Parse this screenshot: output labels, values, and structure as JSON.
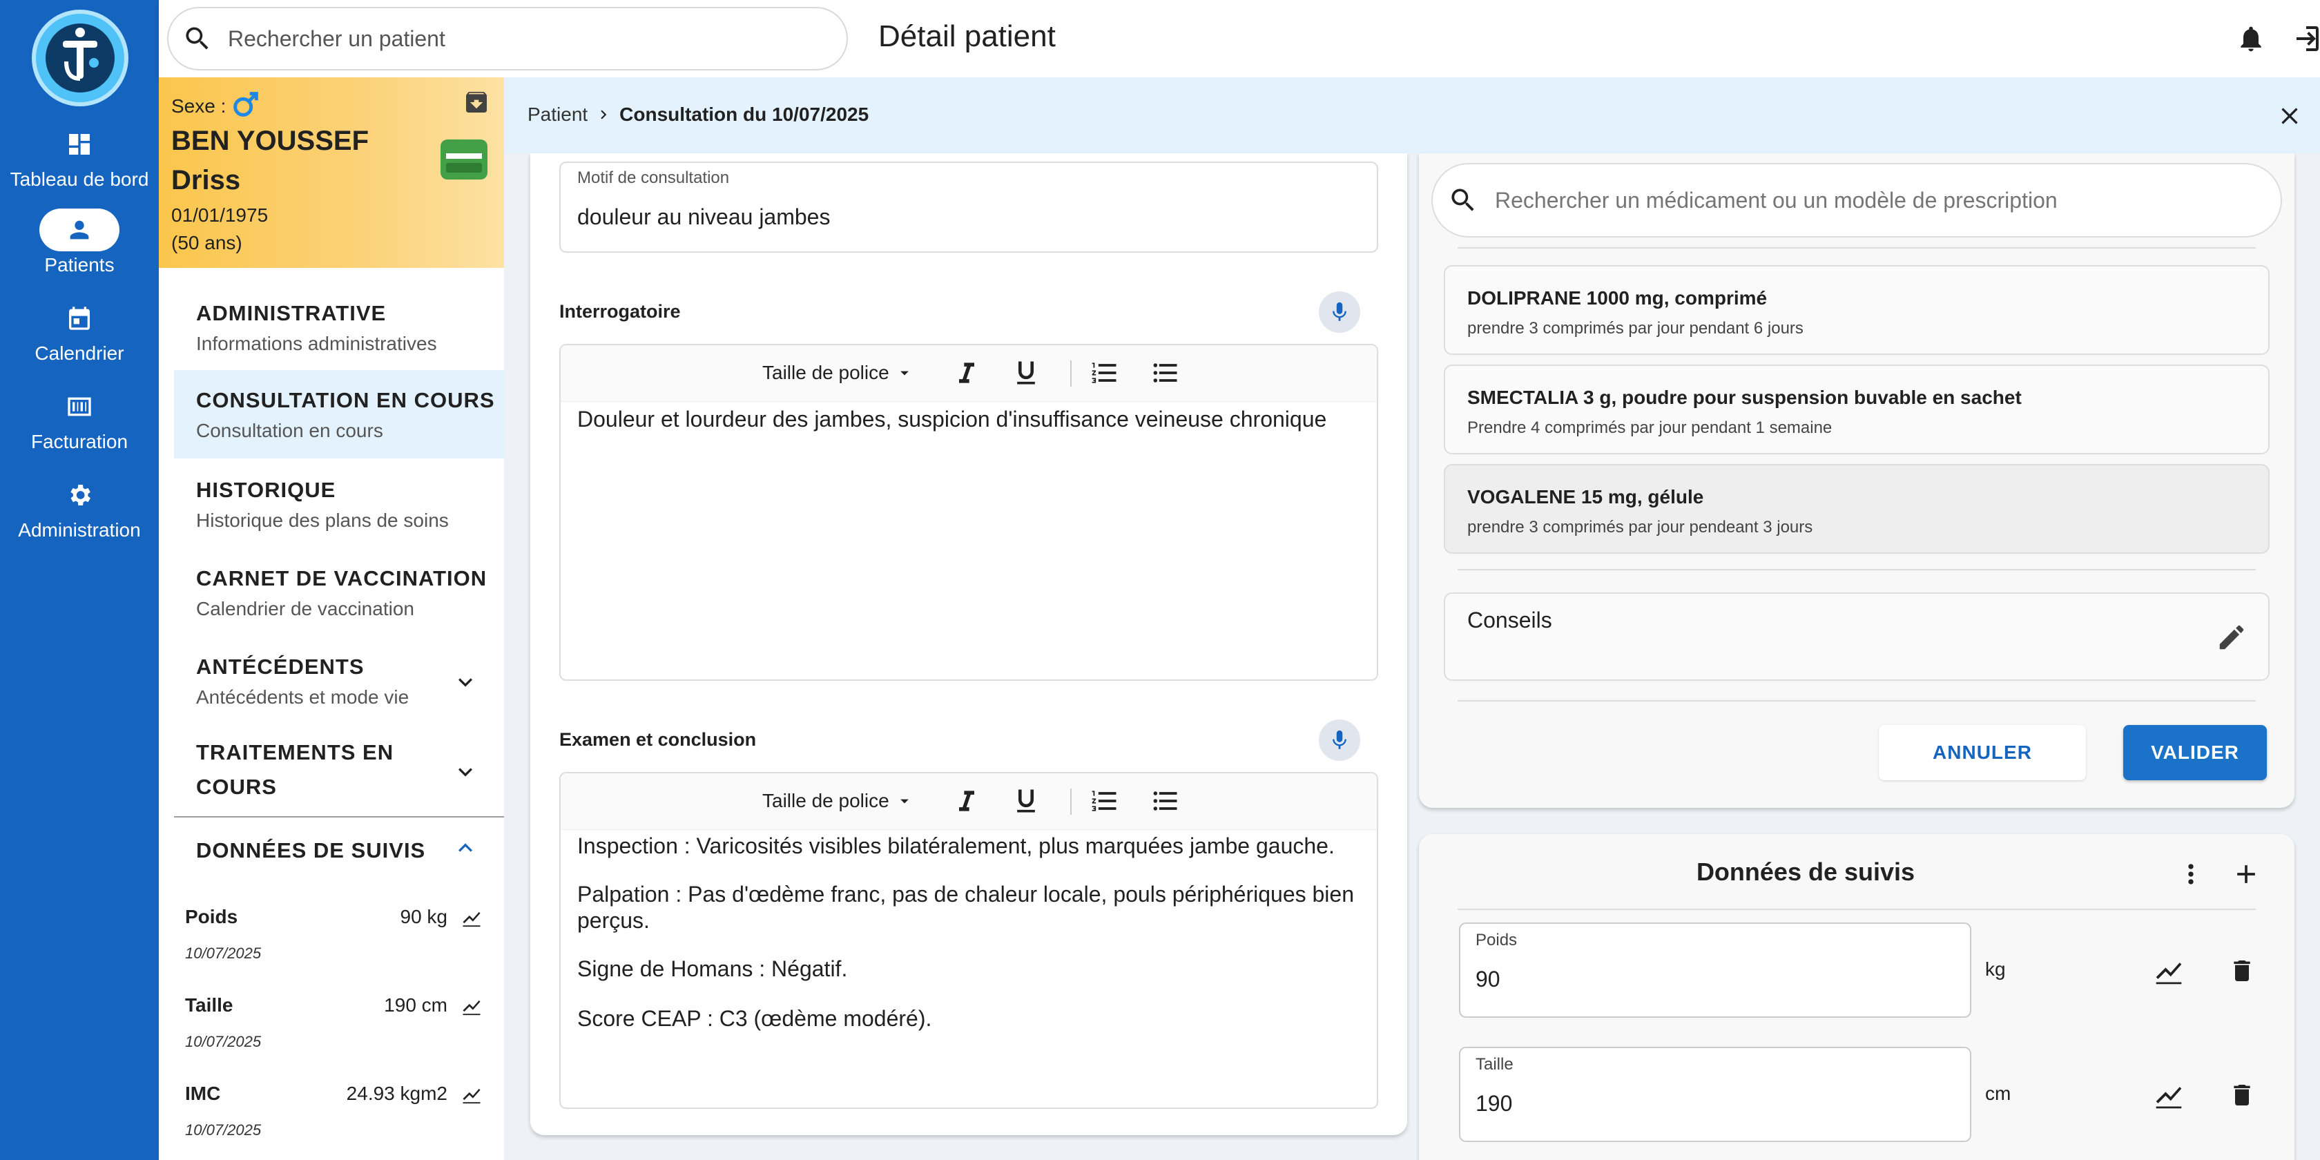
{
  "app": {
    "nav": [
      {
        "label": "Tableau de bord",
        "icon": "dashboard-icon"
      },
      {
        "label": "Patients",
        "icon": "person-icon"
      },
      {
        "label": "Calendrier",
        "icon": "calendar-icon"
      },
      {
        "label": "Facturation",
        "icon": "billing-icon"
      },
      {
        "label": "Administration",
        "icon": "gear-icon"
      }
    ]
  },
  "header": {
    "search_placeholder": "Rechercher un patient",
    "title": "Détail patient"
  },
  "patient": {
    "sex_label": "Sexe :",
    "last_name": "BEN YOUSSEF",
    "first_name": "Driss",
    "birthdate": "01/01/1975",
    "age": "(50 ans)"
  },
  "menu": [
    {
      "title": "ADMINISTRATIVE",
      "subtitle": "Informations administratives"
    },
    {
      "title": "CONSULTATION EN COURS",
      "subtitle": "Consultation en cours"
    },
    {
      "title": "HISTORIQUE",
      "subtitle": "Historique des plans de soins"
    },
    {
      "title": "CARNET DE VACCINATION",
      "subtitle": "Calendrier de vaccination"
    },
    {
      "title": "ANTÉCÉDENTS",
      "subtitle": "Antécédents et mode vie"
    },
    {
      "title_line1": "TRAITEMENTS EN",
      "title_line2": "COURS"
    },
    {
      "title": "DONNÉES DE SUIVIS"
    }
  ],
  "vitals": [
    {
      "label": "Poids",
      "value": "90 kg",
      "date": "10/07/2025"
    },
    {
      "label": "Taille",
      "value": "190 cm",
      "date": "10/07/2025"
    },
    {
      "label": "IMC",
      "value": "24.93 kgm2",
      "date": "10/07/2025"
    }
  ],
  "breadcrumb": {
    "root": "Patient",
    "current": "Consultation du 10/07/2025"
  },
  "consultation": {
    "motif_label": "Motif de consultation",
    "motif_value": "douleur au niveau jambes",
    "interrogatoire_label": "Interrogatoire",
    "font_size_label": "Taille de police",
    "interrogatoire_text": "Douleur et lourdeur des jambes, suspicion d'insuffisance veineuse chronique",
    "examen_label": "Examen et conclusion",
    "examen_lines": [
      "Inspection : Varicosités visibles bilatéralement, plus marquées jambe gauche.",
      "Palpation : Pas d'œdème franc, pas de chaleur locale, pouls périphériques bien perçus.",
      "Signe de Homans : Négatif.",
      "Score CEAP : C3 (œdème modéré)."
    ]
  },
  "prescription": {
    "search_placeholder": "Rechercher un médicament ou un modèle de prescription",
    "items": [
      {
        "name": "DOLIPRANE 1000 mg, comprimé",
        "posology": "prendre 3 comprimés par jour pendant 6 jours"
      },
      {
        "name": "SMECTALIA 3 g, poudre pour suspension buvable en sachet",
        "posology": "Prendre 4 comprimés par jour pendant 1 semaine"
      },
      {
        "name": "VOGALENE 15 mg, gélule",
        "posology": "prendre 3 comprimés par jour pendeant 3 jours"
      }
    ],
    "conseils_label": "Conseils",
    "cancel_label": "ANNULER",
    "validate_label": "VALIDER"
  },
  "suivis": {
    "title": "Données de suivis",
    "rows": [
      {
        "label": "Poids",
        "value": "90",
        "unit": "kg"
      },
      {
        "label": "Taille",
        "value": "190",
        "unit": "cm"
      }
    ]
  },
  "colors": {
    "primary": "#1565c0",
    "accent": "#42a5f5",
    "patient_card": "#fbc64c",
    "male_symbol": "#1e88e5"
  }
}
